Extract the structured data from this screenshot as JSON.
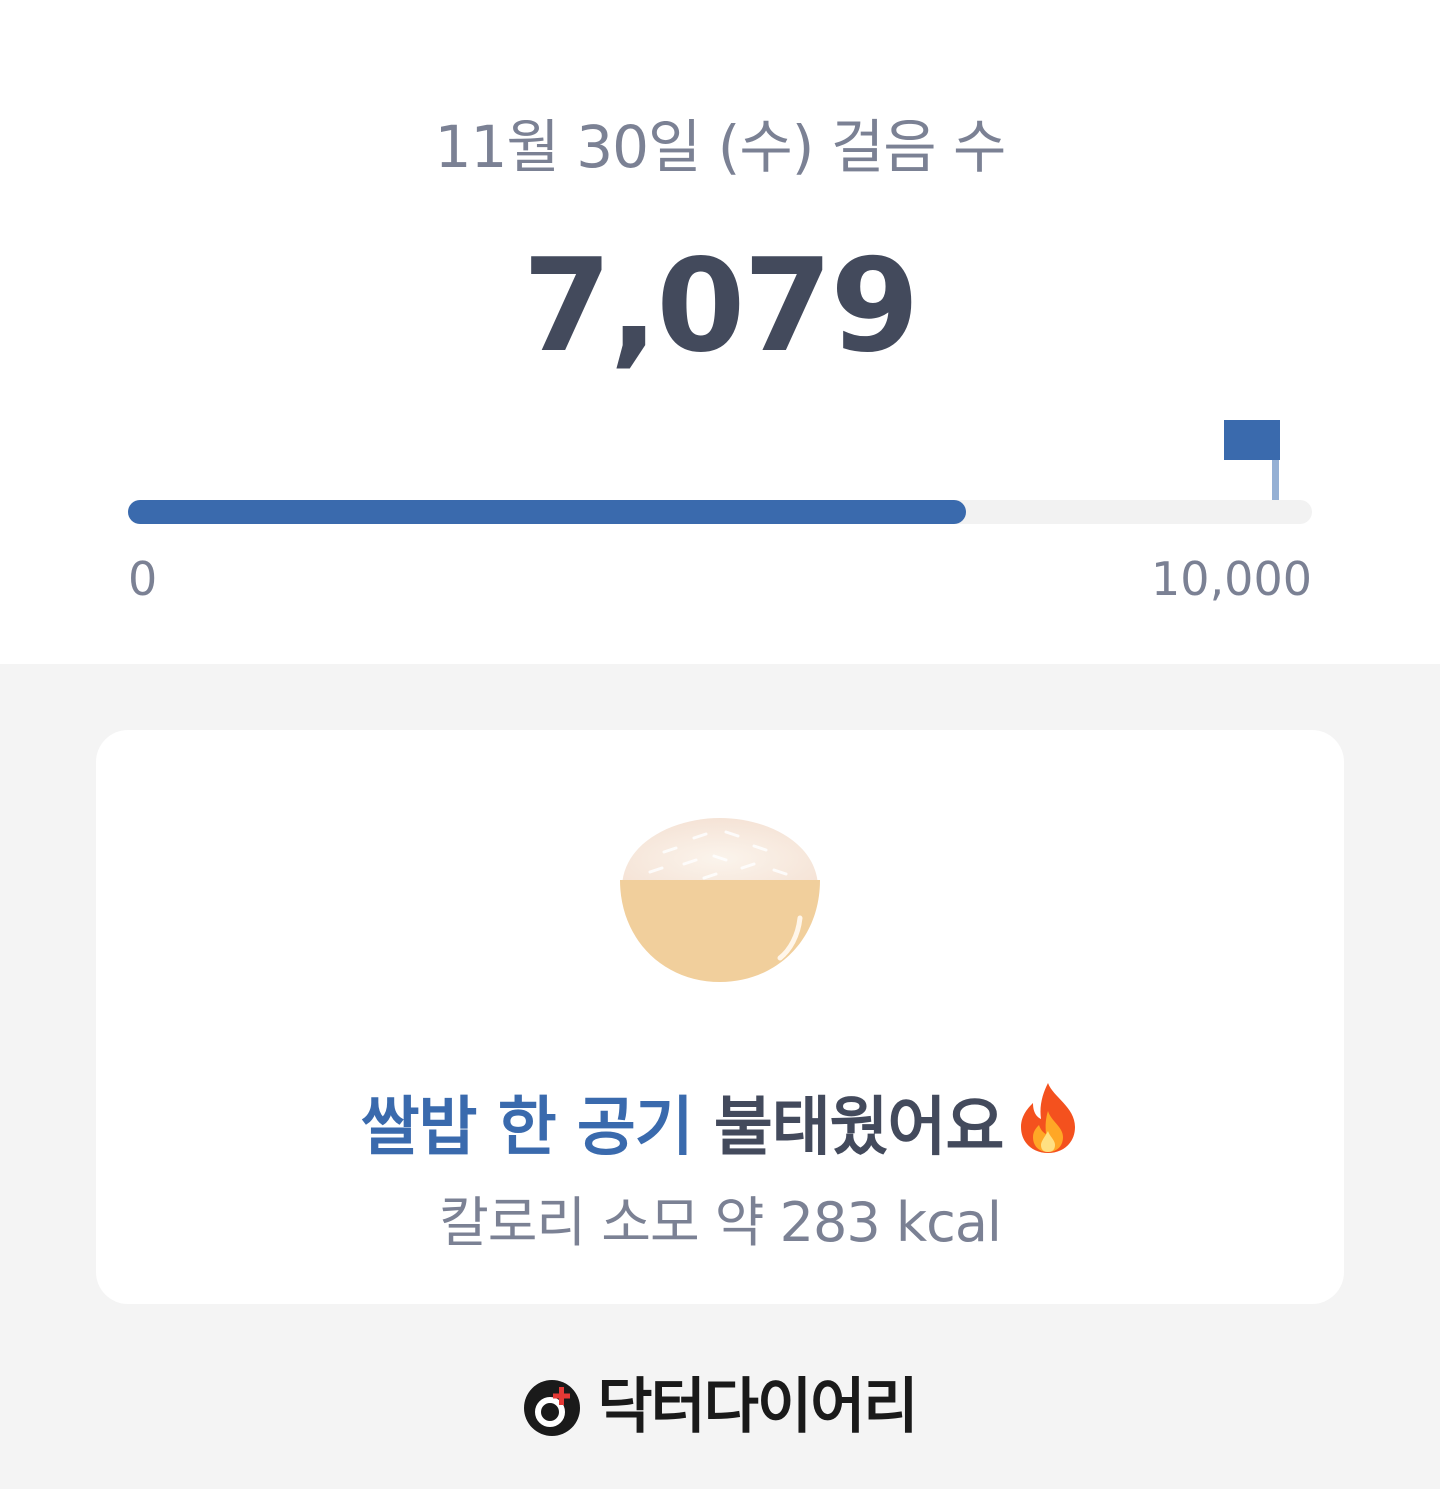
{
  "header": {
    "date_title": "11월 30일 (수) 걸음 수",
    "step_count": "7,079"
  },
  "progress": {
    "current": 7079,
    "goal": 10000,
    "fill_fraction": 0.7079,
    "min_label": "0",
    "max_label": "10,000"
  },
  "card": {
    "food_icon": "rice-bowl-icon",
    "headline_accent": "쌀밥 한 공기",
    "headline_rest": " 불태웠어요",
    "headline_icon": "fire-icon",
    "calorie_text": "칼로리 소모 약 283 kcal"
  },
  "footer": {
    "brand_icon": "doctor-diary-logo-icon",
    "brand_name": "닥터다이어리"
  },
  "colors": {
    "accent": "#3a6aad",
    "text_dark": "#434a5c",
    "text_muted": "#7b8194",
    "background": "#f4f4f4",
    "bowl": "#f1cf9c"
  }
}
